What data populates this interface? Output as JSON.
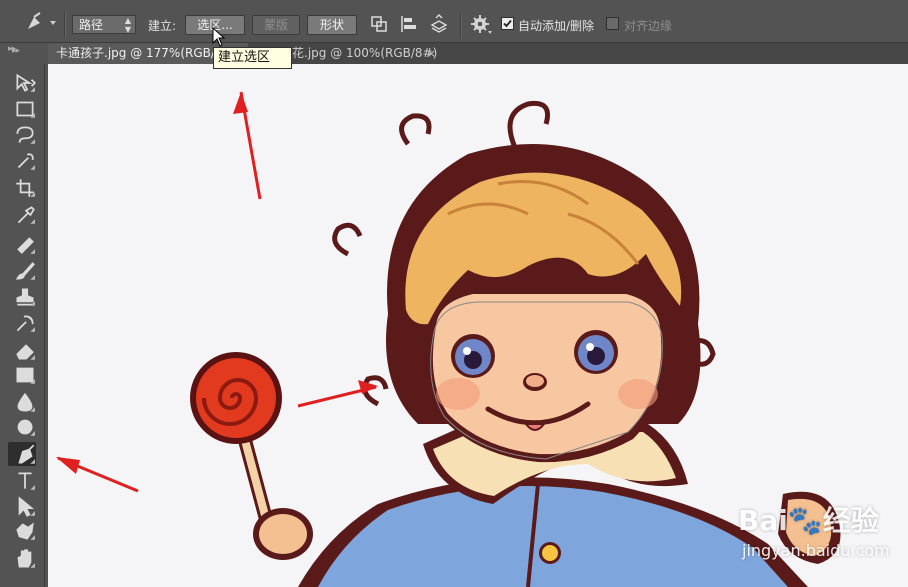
{
  "options_bar": {
    "mode_select": {
      "value": "路径"
    },
    "make_label": "建立:",
    "selection_button": "选区...",
    "mask_button": "蒙版",
    "shape_button": "形状",
    "auto_add_delete": {
      "label": "自动添加/删除",
      "checked": true
    },
    "align_edges": {
      "label": "对齐边缘",
      "checked": false
    }
  },
  "tabs": [
    {
      "label": "卡通孩子.jpg @ 177%(RGB/8",
      "active": true
    },
    {
      "label": "花.jpg @ 100%(RGB/8#)",
      "active": false,
      "close": "×"
    }
  ],
  "tooltip": "建立选区",
  "toolbar": {
    "tools": [
      "move-tool-icon",
      "marquee-tool-icon",
      "lasso-tool-icon",
      "quick-selection-tool-icon",
      "crop-tool-icon",
      "eyedropper-tool-icon",
      "healing-brush-tool-icon",
      "brush-tool-icon",
      "clone-stamp-tool-icon",
      "history-brush-tool-icon",
      "eraser-tool-icon",
      "gradient-tool-icon",
      "blur-tool-icon",
      "dodge-tool-icon",
      "pen-tool-icon",
      "type-tool-icon",
      "path-selection-tool-icon",
      "custom-shape-tool-icon",
      "hand-tool-icon",
      "zoom-tool-icon"
    ],
    "selected": "pen-tool-icon"
  },
  "watermark": {
    "brand": "Bai",
    "brand_cn": "经验",
    "url": "jingyan.baidu.com"
  },
  "colors": {
    "panel": "#535353",
    "canvas": "#f5f5f7",
    "arrow": "#e02020",
    "tooltip": "#ffffe1"
  }
}
